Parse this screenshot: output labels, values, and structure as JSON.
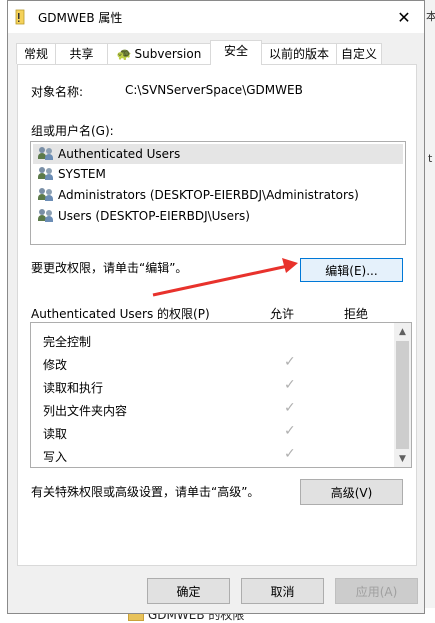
{
  "window": {
    "title": "GDMWEB 属性",
    "close_label": "✕"
  },
  "tabs": [
    {
      "label": "常规"
    },
    {
      "label": "共享"
    },
    {
      "label": "Subversion"
    },
    {
      "label": "安全"
    },
    {
      "label": "以前的版本"
    },
    {
      "label": "自定义"
    }
  ],
  "object_name": {
    "label": "对象名称:",
    "value": "C:\\SVNServerSpace\\GDMWEB"
  },
  "groups": {
    "label": "组或用户名(G):",
    "items": [
      {
        "name": "Authenticated Users"
      },
      {
        "name": "SYSTEM"
      },
      {
        "name": "Administrators (DESKTOP-EIERBDJ\\Administrators)"
      },
      {
        "name": "Users (DESKTOP-EIERBDJ\\Users)"
      }
    ]
  },
  "edit": {
    "hint": "要更改权限，请单击“编辑”。",
    "button_label": "编辑(E)..."
  },
  "permissions": {
    "header": "Authenticated Users 的权限(P)",
    "allow_header": "允许",
    "deny_header": "拒绝",
    "rows": [
      {
        "name": "完全控制",
        "allow": ""
      },
      {
        "name": "修改",
        "allow": "✓"
      },
      {
        "name": "读取和执行",
        "allow": "✓"
      },
      {
        "name": "列出文件夹内容",
        "allow": "✓"
      },
      {
        "name": "读取",
        "allow": "✓"
      },
      {
        "name": "写入",
        "allow": "✓"
      }
    ]
  },
  "advanced": {
    "hint": "有关特殊权限或高级设置，请单击“高级”。",
    "button_label": "高级(V)"
  },
  "footer": {
    "ok_label": "确定",
    "cancel_label": "取消",
    "apply_label": "应用(A)"
  },
  "background": {
    "bottom_text": "GDMWEB 的权限",
    "edge_chars": [
      "本",
      "t"
    ]
  },
  "colors": {
    "arrow": "#e8322c",
    "accent": "#0078d7"
  }
}
